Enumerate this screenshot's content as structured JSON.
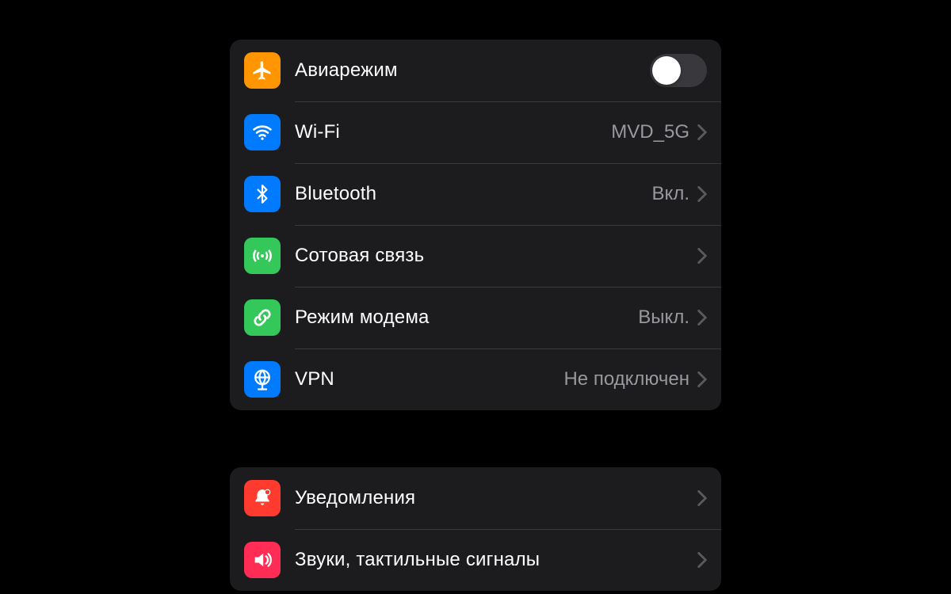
{
  "groups": [
    {
      "items": [
        {
          "id": "airplane",
          "label": "Авиарежим",
          "value": "",
          "control": "toggle",
          "toggle_on": false,
          "icon": "airplane",
          "icon_bg": "orange"
        },
        {
          "id": "wifi",
          "label": "Wi-Fi",
          "value": "MVD_5G",
          "control": "chevron",
          "icon": "wifi",
          "icon_bg": "blue"
        },
        {
          "id": "bluetooth",
          "label": "Bluetooth",
          "value": "Вкл.",
          "control": "chevron",
          "icon": "bluetooth",
          "icon_bg": "blue"
        },
        {
          "id": "cellular",
          "label": "Сотовая связь",
          "value": "",
          "control": "chevron",
          "icon": "antenna",
          "icon_bg": "green"
        },
        {
          "id": "hotspot",
          "label": "Режим модема",
          "value": "Выкл.",
          "control": "chevron",
          "icon": "link",
          "icon_bg": "green"
        },
        {
          "id": "vpn",
          "label": "VPN",
          "value": "Не подключен",
          "control": "chevron",
          "icon": "globe",
          "icon_bg": "blue"
        }
      ]
    },
    {
      "items": [
        {
          "id": "notifications",
          "label": "Уведомления",
          "value": "",
          "control": "chevron",
          "icon": "bell",
          "icon_bg": "red"
        },
        {
          "id": "sounds",
          "label": "Звуки, тактильные сигналы",
          "value": "",
          "control": "chevron",
          "icon": "speaker",
          "icon_bg": "pink"
        }
      ]
    }
  ]
}
